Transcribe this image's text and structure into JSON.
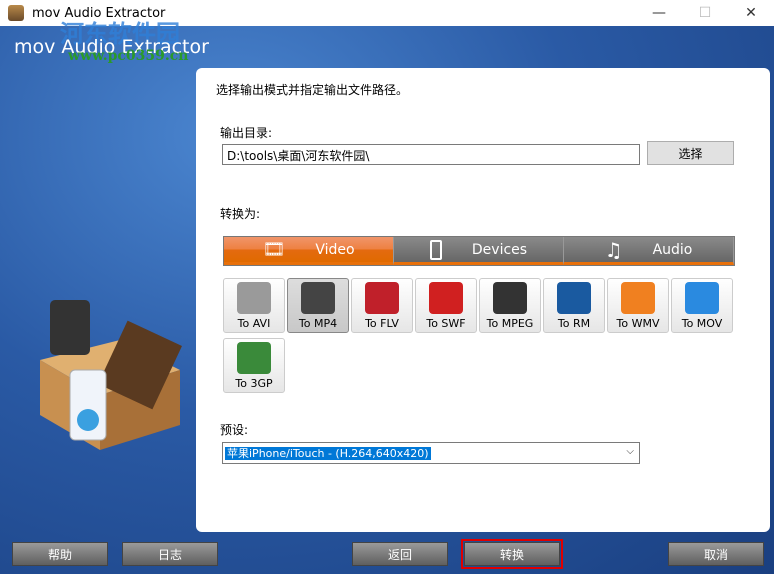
{
  "window": {
    "title": "mov Audio Extractor",
    "minimize": "—",
    "maximize": "☐",
    "close": "✕"
  },
  "banner": {
    "title": "mov Audio Extractor",
    "watermark": "河东软件园",
    "watermark_url": "www.pc0359.cn"
  },
  "panel": {
    "instruction": "选择输出模式并指定输出文件路径。",
    "output_dir_label": "输出目录:",
    "output_dir_value": "D:\\tools\\桌面\\河东软件园\\",
    "browse_label": "选择",
    "convert_to_label": "转换为:",
    "tabs": [
      {
        "label": "Video",
        "icon": "film-icon"
      },
      {
        "label": "Devices",
        "icon": "phone-icon"
      },
      {
        "label": "Audio",
        "icon": "music-note-icon"
      }
    ],
    "active_tab": "Video",
    "formats": [
      {
        "label": "To AVI",
        "color": "#9a9a9a"
      },
      {
        "label": "To MP4",
        "color": "#444"
      },
      {
        "label": "To FLV",
        "color": "#c0202a"
      },
      {
        "label": "To SWF",
        "color": "#d02020"
      },
      {
        "label": "To MPEG",
        "color": "#333"
      },
      {
        "label": "To RM",
        "color": "#1a5aa0"
      },
      {
        "label": "To WMV",
        "color": "#f08020"
      },
      {
        "label": "To MOV",
        "color": "#2a8ae0"
      },
      {
        "label": "To 3GP",
        "color": "#3a8a3a"
      }
    ],
    "selected_format": "To MP4",
    "preset_label": "预设:",
    "preset_value": "苹果iPhone/iTouch - (H.264,640x420)"
  },
  "footer": {
    "help": "帮助",
    "log": "日志",
    "back": "返回",
    "convert": "转换",
    "cancel": "取消"
  }
}
